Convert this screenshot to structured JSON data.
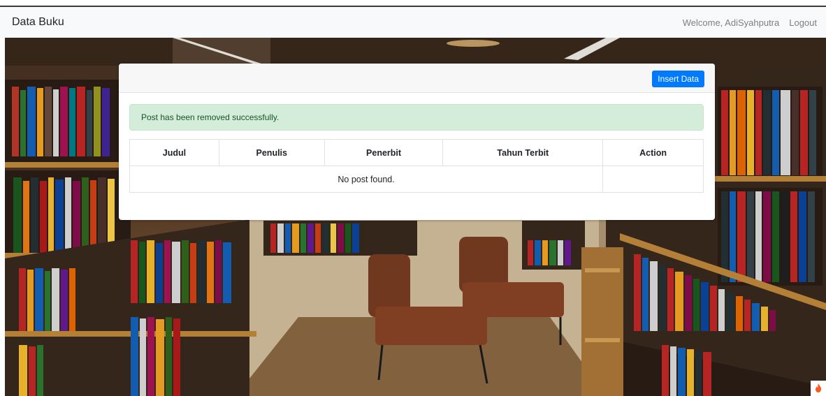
{
  "navbar": {
    "brand": "Data Buku",
    "welcome": "Welcome, AdiSyahputra",
    "logout": "Logout"
  },
  "card": {
    "insert_button": "Insert Data",
    "alert_message": "Post has been removed successfully."
  },
  "table": {
    "headers": [
      "Judul",
      "Penulis",
      "Penerbit",
      "Tahun Terbit",
      "Action"
    ],
    "empty_message": "No post found."
  },
  "background": {
    "description_icon": "library-bookshelf-background"
  },
  "colors": {
    "primary": "#007bff",
    "alert_bg": "#d4edda",
    "alert_text": "#155724",
    "flame": "#ff5722"
  }
}
